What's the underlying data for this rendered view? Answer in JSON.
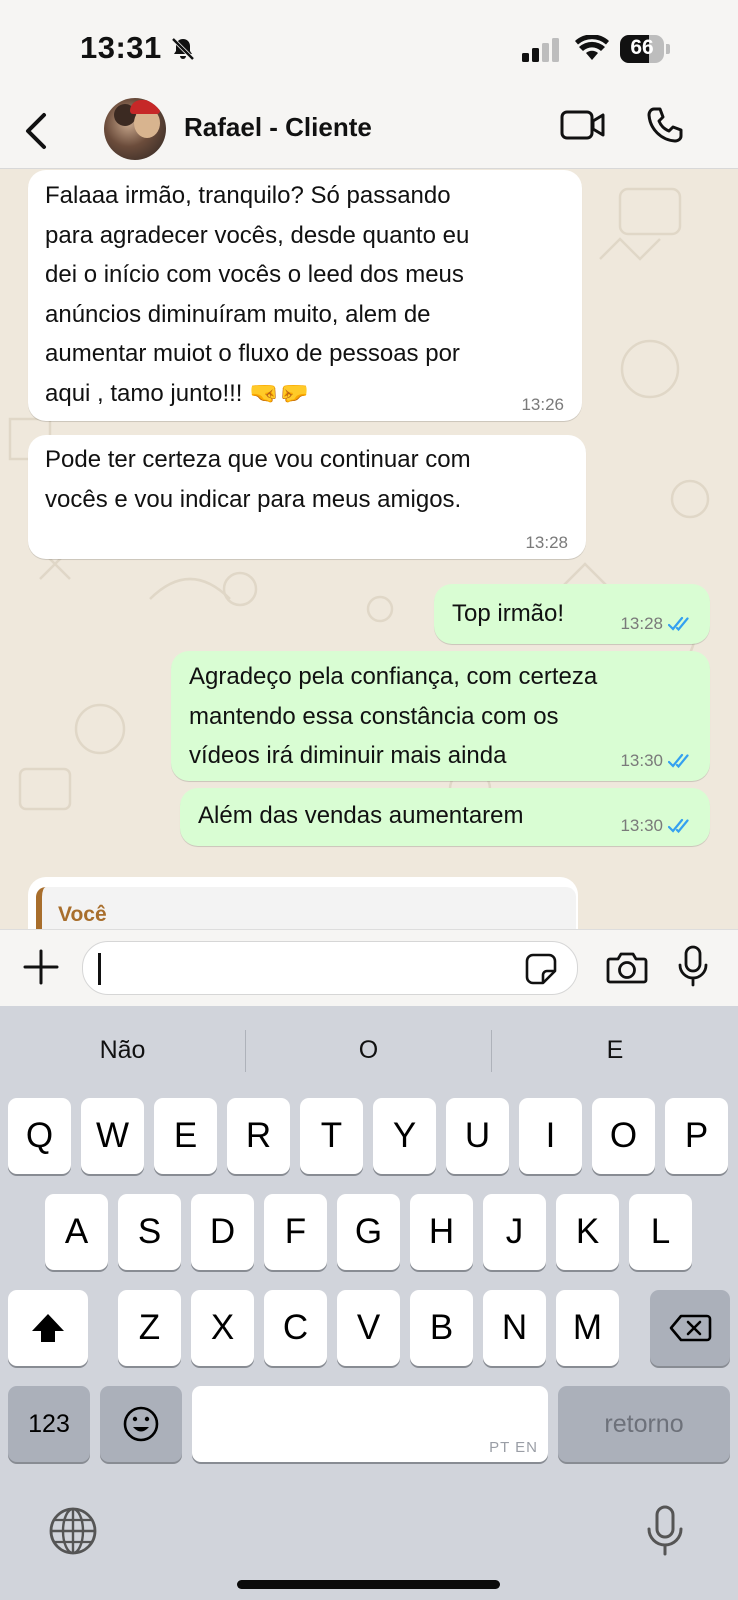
{
  "status_bar": {
    "time": "13:31",
    "battery": "66",
    "battery_level": 0.66,
    "icons": [
      "bell-slash-icon",
      "cellular-signal-icon",
      "wifi-icon",
      "battery-icon"
    ]
  },
  "header": {
    "contact_name": "Rafael - Cliente",
    "icons": [
      "back-chevron-icon",
      "video-call-icon",
      "phone-icon"
    ]
  },
  "messages": [
    {
      "direction": "incoming",
      "text": "Falaaa irmão, tranquilo? Só passando\npara agradecer vocês, desde quanto eu\ndei o início com vocês o leed dos meus\nanúncios diminuíram muito, alem de\naumentar muiot o fluxo de pessoas por\naqui , tamo junto!!! 🤜🤛",
      "time": "13:26"
    },
    {
      "direction": "incoming",
      "text": "Pode ter certeza que vou continuar com\nvocês e vou indicar para meus amigos.",
      "time": "13:28"
    },
    {
      "direction": "outgoing",
      "text": "Top irmão!",
      "time": "13:28",
      "status": "read"
    },
    {
      "direction": "outgoing",
      "text": "Agradeço pela confiança, com certeza\nmantendo essa constância com os\nvídeos irá diminuir mais ainda",
      "time": "13:30",
      "status": "read"
    },
    {
      "direction": "outgoing",
      "text": "Além das vendas aumentarem",
      "time": "13:30",
      "status": "read"
    }
  ],
  "quoted_reply": {
    "author": "Você"
  },
  "composer": {
    "value": "",
    "icons": [
      "plus-icon",
      "sticker-icon",
      "camera-icon",
      "microphone-icon"
    ]
  },
  "keyboard": {
    "suggestions": [
      "Não",
      "O",
      "E"
    ],
    "row1": [
      "Q",
      "W",
      "E",
      "R",
      "T",
      "Y",
      "U",
      "I",
      "O",
      "P"
    ],
    "row2": [
      "A",
      "S",
      "D",
      "F",
      "G",
      "H",
      "J",
      "K",
      "L"
    ],
    "row3": [
      "Z",
      "X",
      "C",
      "V",
      "B",
      "N",
      "M"
    ],
    "numbers_key": "123",
    "space_lang": "PT EN",
    "return_key": "retorno"
  },
  "colors": {
    "outgoing_bubble": "#d9fdd3",
    "incoming_bubble": "#ffffff",
    "read_ticks": "#34a0f0",
    "quote_accent": "#a86e2c",
    "chat_background": "#efe8dc"
  }
}
